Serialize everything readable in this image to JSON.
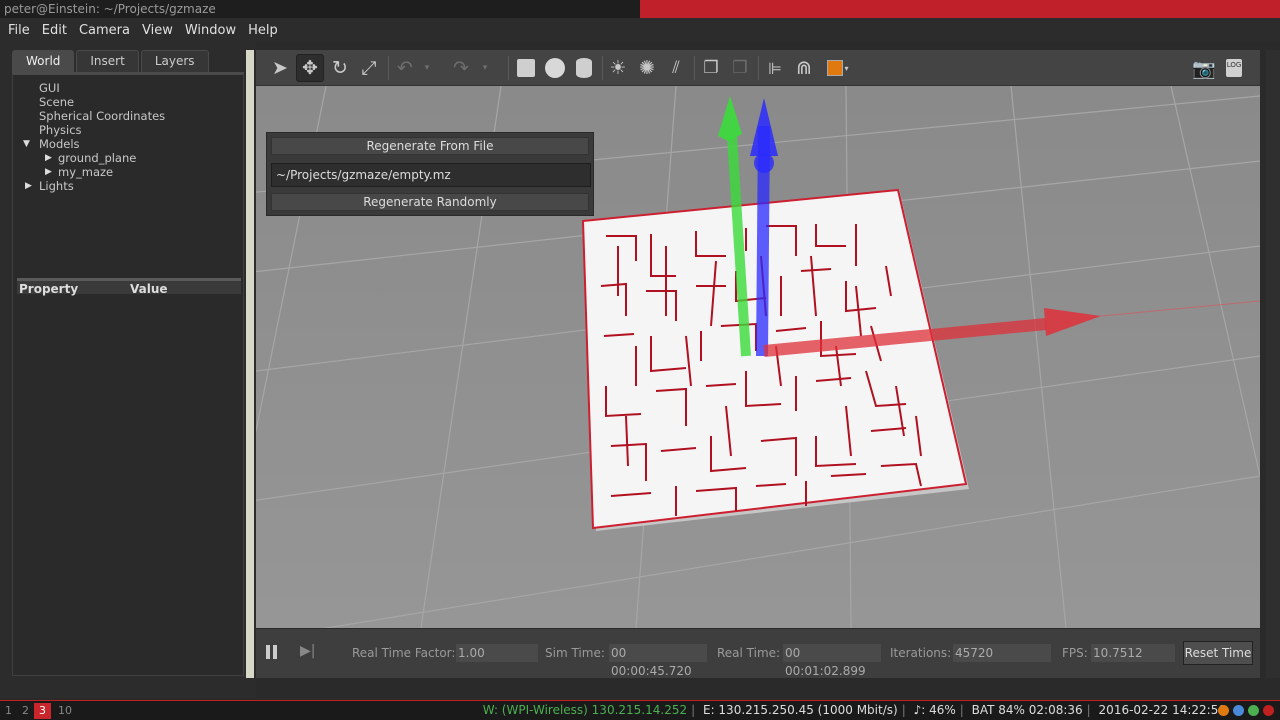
{
  "window_title": "peter@Einstein: ~/Projects/gzmaze",
  "menu": [
    "File",
    "Edit",
    "Camera",
    "View",
    "Window",
    "Help"
  ],
  "tabs": [
    "World",
    "Insert",
    "Layers"
  ],
  "tree": {
    "gui": "GUI",
    "scene": "Scene",
    "spherical": "Spherical Coordinates",
    "physics": "Physics",
    "models": "Models",
    "ground_plane": "ground_plane",
    "my_maze": "my_maze",
    "lights": "Lights"
  },
  "properties": {
    "col_property": "Property",
    "col_value": "Value"
  },
  "toolbar_icons": [
    "select-arrow",
    "translate",
    "rotate",
    "scale",
    "undo",
    "undo-dropdown",
    "redo",
    "redo-dropdown",
    "box",
    "sphere",
    "cylinder",
    "point-light",
    "spot-light",
    "directional-light",
    "copy",
    "paste",
    "align",
    "snap",
    "view-angle",
    "screenshot",
    "log"
  ],
  "maze_panel": {
    "regen_file": "Regenerate From File",
    "file_path": "~/Projects/gzmaze/empty.mz",
    "regen_random": "Regenerate Randomly"
  },
  "bottom": {
    "rtf_label": "Real Time Factor:",
    "rtf_value": "1.00",
    "sim_label": "Sim Time:",
    "sim_value": "00 00:00:45.720",
    "real_label": "Real Time:",
    "real_value": "00 00:01:02.899",
    "iter_label": "Iterations:",
    "iter_value": "45720",
    "fps_label": "FPS:",
    "fps_value": "10.7512",
    "reset": "Reset Time"
  },
  "taskbar": {
    "workspaces": [
      "1",
      "2",
      "3",
      "10"
    ],
    "wireless": "W: (WPI-Wireless) 130.215.14.252",
    "ethernet": "E: 130.215.250.45 (1000 Mbit/s)",
    "volume": "♪: 46%",
    "battery": "BAT 84% 02:08:36",
    "datetime": "2016-02-22 14:22:50"
  },
  "colors": {
    "accent_red": "#c0202a",
    "wireless_green": "#4caf50",
    "x_axis": "#e0303a",
    "y_axis": "#3adb3a",
    "z_axis": "#2a2aff"
  }
}
